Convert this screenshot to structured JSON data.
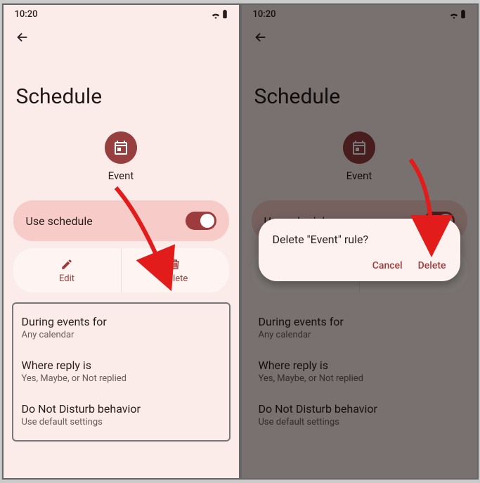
{
  "status": {
    "time": "10:20"
  },
  "page_title": "Schedule",
  "event": {
    "label": "Event"
  },
  "toggle": {
    "label": "Use schedule",
    "on": true
  },
  "actions": {
    "edit": "Edit",
    "delete": "Delete"
  },
  "settings": [
    {
      "title": "During events for",
      "sub": "Any calendar"
    },
    {
      "title": "Where reply is",
      "sub": "Yes, Maybe, or Not replied"
    },
    {
      "title": "Do Not Disturb behavior",
      "sub": "Use default settings"
    }
  ],
  "dialog": {
    "title": "Delete \"Event\" rule?",
    "cancel": "Cancel",
    "delete": "Delete"
  }
}
